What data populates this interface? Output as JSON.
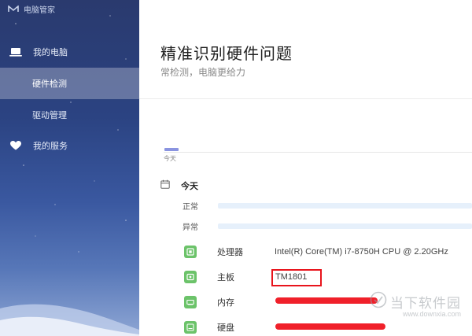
{
  "app": {
    "title": "电脑管家"
  },
  "sidebar": {
    "items": [
      {
        "label": "我的电脑",
        "icon": "laptop-icon"
      },
      {
        "label": "硬件检测",
        "active": true
      },
      {
        "label": "驱动管理"
      },
      {
        "label": "我的服务",
        "icon": "heart-icon"
      }
    ]
  },
  "main": {
    "title": "精准识别硬件问题",
    "subtitle": "常检测，电脑更给力",
    "timeline": {
      "label": "今天"
    },
    "day": {
      "label": "今天",
      "icon": "calendar-icon"
    },
    "statuses": [
      {
        "label": "正常"
      },
      {
        "label": "异常"
      }
    ],
    "hardware": [
      {
        "name": "处理器",
        "value": "Intel(R) Core(TM) i7-8750H CPU @ 2.20GHz",
        "icon": "cpu-icon"
      },
      {
        "name": "主板",
        "value": "TM1801",
        "icon": "motherboard-icon"
      },
      {
        "name": "内存",
        "value": "",
        "icon": "memory-icon"
      },
      {
        "name": "硬盘",
        "value": "",
        "icon": "disk-icon"
      }
    ]
  },
  "watermark": {
    "name": "当下软件园",
    "url": "www.downxia.com",
    "icon": "watermark-logo-icon"
  },
  "colors": {
    "accent_green": "#6cc36a",
    "redact": "#f0202a",
    "sidebar_active": "#8a9cc6"
  }
}
